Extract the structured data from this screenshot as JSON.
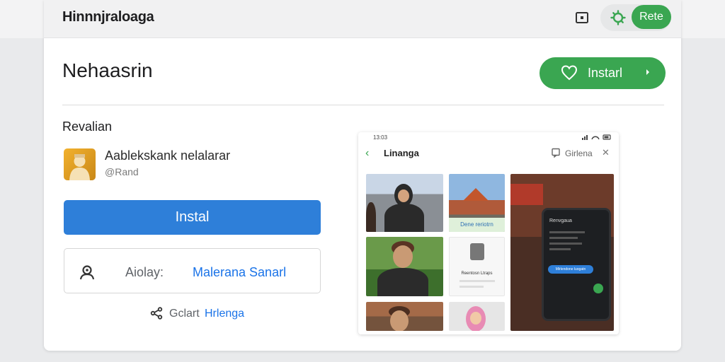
{
  "header": {
    "brand": "Hinnnjraloaga",
    "rate_label": "Rete",
    "icons": [
      "cast-icon",
      "gear-icon"
    ]
  },
  "main": {
    "title": "Nehaasrin",
    "install_top_label": "Instarl",
    "section_label": "Revalian",
    "app": {
      "name": "Aablekskank nelalarar",
      "handle": "@Rand"
    },
    "install_main_label": "Instal",
    "account": {
      "label": "Aiolay:",
      "name": "Malerana Sanarl"
    },
    "share": {
      "prefix": "Gclart",
      "name": "Hrlenga"
    }
  },
  "preview": {
    "status_left": "13:03",
    "title": "Linanga",
    "right_label": "Girlena",
    "tile2_caption": "Dene reriotrn",
    "tile4_caption": "Reentosn Ltraps",
    "phone_title": "Renvgaua",
    "phone_bubble": "Mlrlendone luogatn"
  },
  "colors": {
    "accent_green": "#3aa651",
    "accent_blue": "#2e7fd9",
    "link_blue": "#1a73e8"
  }
}
